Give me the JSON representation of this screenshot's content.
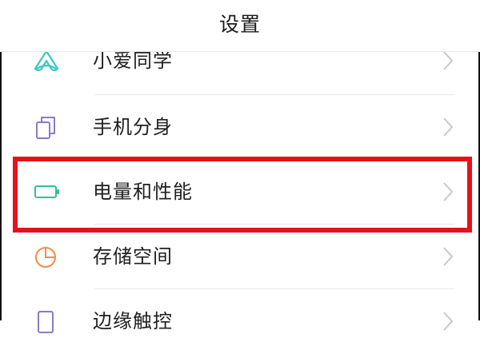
{
  "header": {
    "title": "设置"
  },
  "settings": {
    "items": [
      {
        "label": "小爱同学",
        "icon": "xiaoai-icon"
      },
      {
        "label": "手机分身",
        "icon": "phone-clone-icon"
      },
      {
        "label": "电量和性能",
        "icon": "battery-icon"
      },
      {
        "label": "存储空间",
        "icon": "storage-pie-icon"
      },
      {
        "label": "边缘触控",
        "icon": "edge-touch-icon"
      }
    ]
  },
  "highlight": {
    "color": "#e5121b",
    "target_item": "电量和性能"
  },
  "colors": {
    "xiaoai_icon": "#3cc7c4",
    "clone_icon": "#8b79c8",
    "battery_icon": "#2fbfa1",
    "storage_icon": "#f08d4b",
    "edge_icon": "#8b79c8",
    "chevron": "#c8c8c8"
  }
}
